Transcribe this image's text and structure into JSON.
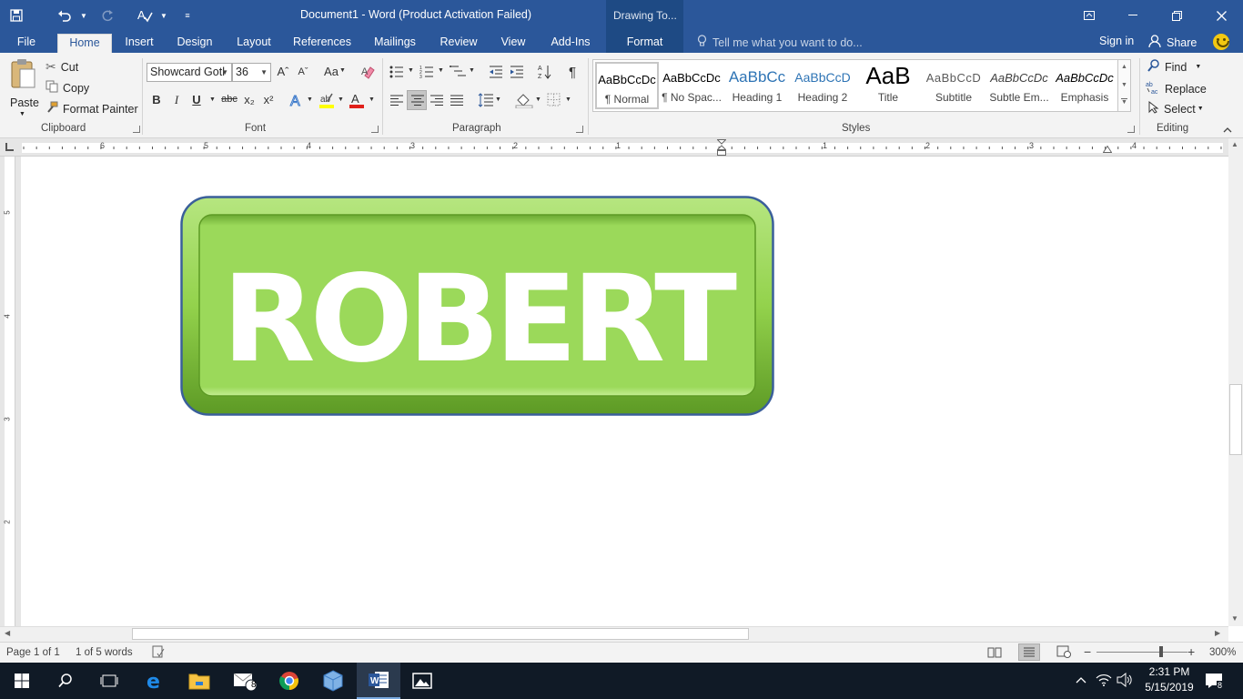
{
  "window": {
    "title": "Document1 - Word (Product Activation Failed)",
    "context_banner": "Drawing To..."
  },
  "tabs": {
    "file": "File",
    "home": "Home",
    "insert": "Insert",
    "design": "Design",
    "layout": "Layout",
    "references": "References",
    "mailings": "Mailings",
    "review": "Review",
    "view": "View",
    "addins": "Add-Ins",
    "format": "Format"
  },
  "header": {
    "tell_me": "Tell me what you want to do...",
    "sign_in": "Sign in",
    "share": "Share"
  },
  "clipboard": {
    "paste": "Paste",
    "cut": "Cut",
    "copy": "Copy",
    "format_painter": "Format Painter",
    "label": "Clipboard"
  },
  "font": {
    "name": "Showcard Gotl",
    "size": "36",
    "label": "Font",
    "bold": "B",
    "italic": "I",
    "underline": "U",
    "strike": "abc",
    "subscript": "x₂",
    "superscript": "x²",
    "change_case": "Aa",
    "grow": "Aˆ",
    "shrink": "Aˇ"
  },
  "paragraph": {
    "label": "Paragraph",
    "pilcrow": "¶"
  },
  "styles": {
    "label": "Styles",
    "items": [
      {
        "sample": "AaBbCcDc",
        "name": "¶ Normal"
      },
      {
        "sample": "AaBbCcDc",
        "name": "¶ No Spac..."
      },
      {
        "sample": "AaBbCc",
        "name": "Heading 1"
      },
      {
        "sample": "AaBbCcD",
        "name": "Heading 2"
      },
      {
        "sample": "AaB",
        "name": "Title"
      },
      {
        "sample": "AaBbCcD",
        "name": "Subtitle"
      },
      {
        "sample": "AaBbCcDc",
        "name": "Subtle Em..."
      },
      {
        "sample": "AaBbCcDc",
        "name": "Emphasis"
      }
    ]
  },
  "editing": {
    "label": "Editing",
    "find": "Find",
    "replace": "Replace",
    "select": "Select"
  },
  "ruler": {
    "numbers": [
      "6",
      "5",
      "4",
      "3",
      "2",
      "1",
      "1",
      "2",
      "3",
      "4"
    ],
    "vertical_numbers": [
      "5",
      "4",
      "3",
      "2"
    ]
  },
  "document": {
    "shape_text": "ROBERT",
    "shape_fill": "#9bd95a",
    "shape_border": "#3a5f9a"
  },
  "status": {
    "page": "Page 1 of 1",
    "words": "1 of 5 words",
    "zoom": "300%"
  },
  "taskbar": {
    "time": "2:31 PM",
    "date": "5/15/2019",
    "mail_badge": "8",
    "notification_count": "8"
  }
}
